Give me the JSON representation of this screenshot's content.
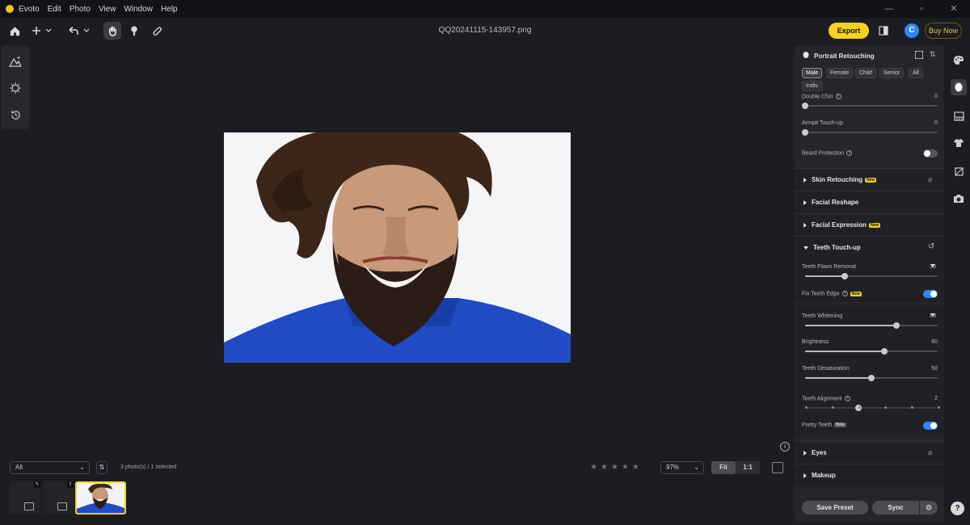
{
  "app": {
    "name": "Evoto",
    "menu": [
      "Edit",
      "Photo",
      "View",
      "Window",
      "Help"
    ]
  },
  "toolbar": {
    "filename": "QQ20241115-143957.png",
    "export_label": "Export",
    "avatar_letter": "C",
    "buy_label": "Buy Now"
  },
  "viewer": {
    "info_glyph": "i"
  },
  "bottom": {
    "filter_value": "All",
    "count_text": "3 photo(s) / 1 selected",
    "zoom_value": "97%",
    "fit_label": "Fit",
    "one_to_one_label": "1:1",
    "star_count": 5
  },
  "panel": {
    "title": "Portrait Retouching",
    "gender_chips": [
      "Male",
      "Female",
      "Child",
      "Senior",
      "All",
      "Indiv."
    ],
    "active_chip": "Male",
    "double_chin": {
      "label": "Double Chin",
      "value": "0",
      "pct": 0
    },
    "armpit": {
      "label": "Armpit Touch-up",
      "value": "0",
      "pct": 0
    },
    "beard": {
      "label": "Beard Protection",
      "on": false
    },
    "new_tag": "New",
    "beta_tag": "Beta",
    "sections": {
      "skin": "Skin Retouching",
      "reshape": "Facial Reshape",
      "expression": "Facial Expression",
      "teeth": "Teeth Touch-up",
      "eyes": "Eyes",
      "makeup": "Makeup"
    },
    "teeth_flaws": {
      "label": "Teeth Flaws Removal",
      "value": "30",
      "pct": 30
    },
    "fix_edge": {
      "label": "Fix Teeth Edge",
      "on": true
    },
    "whitening": {
      "label": "Teeth Whitening",
      "value": "69",
      "pct": 69
    },
    "brightness": {
      "label": "Brightness",
      "value": "60",
      "pct": 60
    },
    "desaturation": {
      "label": "Teeth Desaturation",
      "value": "50",
      "pct": 50
    },
    "alignment": {
      "label": "Teeth Alignment",
      "value": "2",
      "step": 2,
      "steps": 6
    },
    "pretty": {
      "label": "Pretty Teeth",
      "on": true
    },
    "save_preset": "Save Preset",
    "sync": "Sync"
  },
  "help_label": "?",
  "colors": {
    "accent": "#f6d21f",
    "toggle_on": "#2e86ff",
    "toggle_off": "#55575c"
  }
}
